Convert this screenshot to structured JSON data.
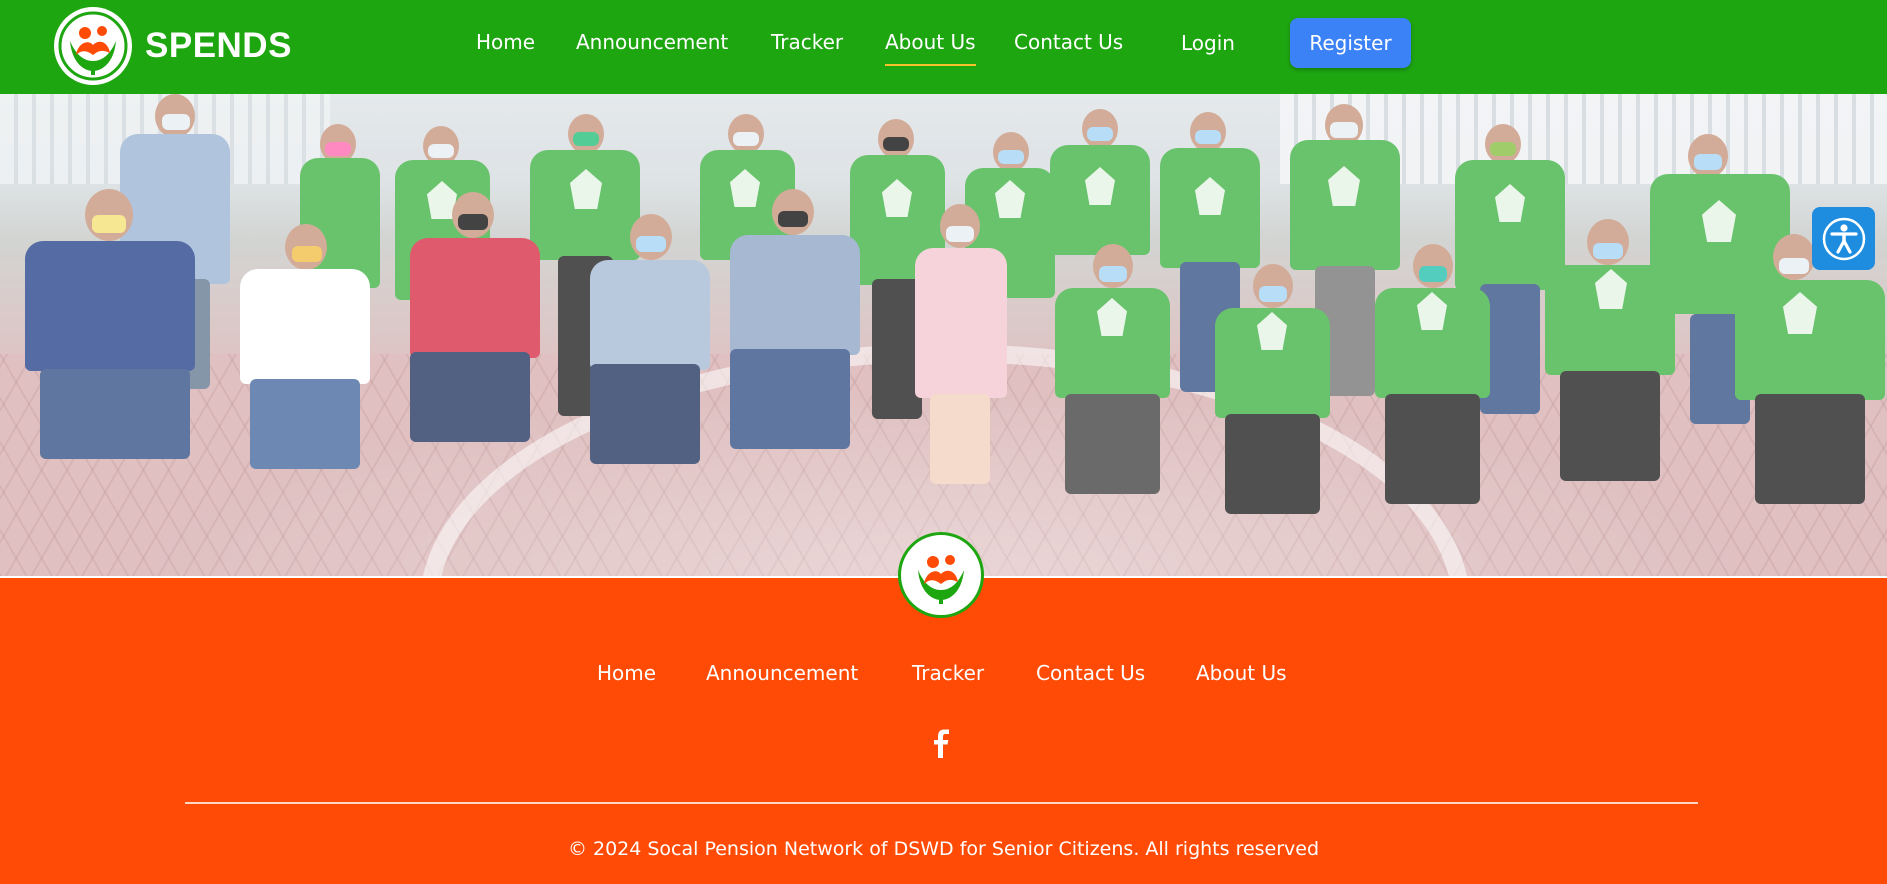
{
  "header": {
    "brand_name": "SPENDS",
    "nav": [
      {
        "label": "Home"
      },
      {
        "label": "Announcement"
      },
      {
        "label": "Tracker"
      },
      {
        "label": "About Us",
        "active": true
      },
      {
        "label": "Contact Us"
      }
    ],
    "login_label": "Login",
    "register_label": "Register"
  },
  "hero": {
    "image_alt": "Group photo of senior citizens holding plaques",
    "accessibility_icon": "accessibility-icon"
  },
  "footer": {
    "nav": [
      {
        "label": "Home"
      },
      {
        "label": "Announcement"
      },
      {
        "label": "Tracker"
      },
      {
        "label": "Contact Us"
      },
      {
        "label": "About Us"
      }
    ],
    "social_icon": "facebook-icon",
    "copyright": "© 2024 Socal Pension Network of DSWD for Senior Citizens. All rights reserved"
  },
  "colors": {
    "header_bg": "#1ea611",
    "footer_bg": "#ff4b05",
    "register_bg": "#3b82f6",
    "active_underline": "#f4c22b",
    "accessibility_bg": "#1e8de0"
  }
}
